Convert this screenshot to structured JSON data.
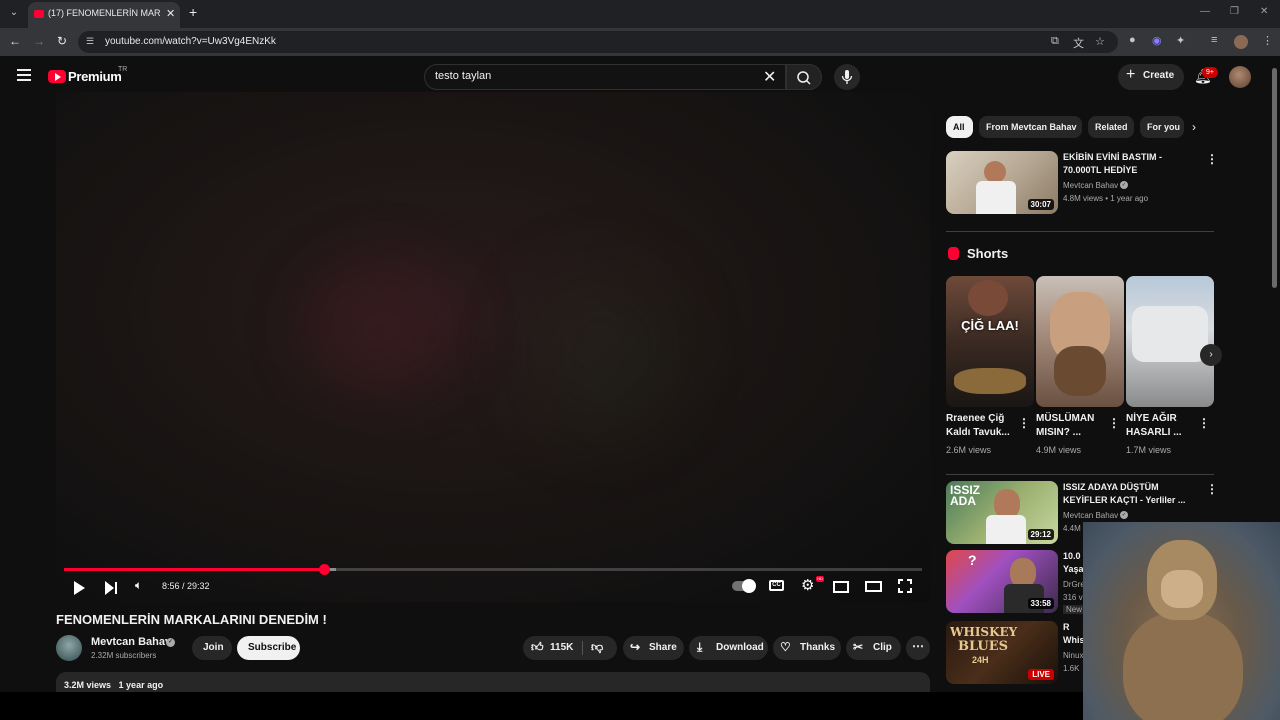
{
  "browser": {
    "tab_title": "(17) FENOMENLERİN MARKALA",
    "url": "youtube.com/watch?v=Uw3Vg4ENzKk"
  },
  "masthead": {
    "logo_text": "Premium",
    "country": "TR",
    "search_value": "testo taylan",
    "create_label": "Create",
    "notification_count": "9+"
  },
  "player": {
    "time": "8:56 / 29:32",
    "progress_fraction": 0.303,
    "buffered_fraction": 0.317
  },
  "video": {
    "title": "FENOMENLERİN MARKALARINI DENEDİM !",
    "channel": "Mevtcan Bahav",
    "subscribers": "2.32M subscribers",
    "join_label": "Join",
    "subscribe_label": "Subscribe",
    "likes": "115K",
    "share_label": "Share",
    "download_label": "Download",
    "thanks_label": "Thanks",
    "clip_label": "Clip",
    "views": "3.2M views",
    "age": "1 year ago"
  },
  "chips": [
    "All",
    "From Mevtcan Bahav",
    "Related",
    "For you"
  ],
  "recommendations": [
    {
      "title1": "EKİBİN EVİNİ BASTIM -",
      "title2": "70.000TL HEDİYE",
      "channel": "Mevtcan Bahav",
      "meta": "4.8M views • 1 year ago",
      "duration": "30:07"
    },
    {
      "title1": "ISSIZ ADAYA DÜŞTÜM",
      "title2": "KEYİFLER KAÇTI - Yerliler ...",
      "channel": "Mevtcan Bahav",
      "meta": "4.4M",
      "duration": "29:12",
      "thumb_text": "ISSIZ ADA"
    },
    {
      "title1": "10.0",
      "title2": "Yaşa",
      "channel": "DrGre",
      "meta": "316 v",
      "badge": "New",
      "duration": "33:58"
    },
    {
      "title1": "R",
      "title2": "Whis",
      "channel": "Ninux",
      "meta": "1.6K",
      "live_label": "LIVE",
      "thumb_text1": "WHISKEY",
      "thumb_text2": "BLUES",
      "thumb_text3": "24H"
    }
  ],
  "shorts": {
    "heading": "Shorts",
    "items": [
      {
        "title1": "Rraenee Çiğ",
        "title2": "Kaldı Tavuk...",
        "views": "2.6M views",
        "overlay": "ÇİĞ LAA!"
      },
      {
        "title1": "MÜSLÜMAN",
        "title2": "MISIN? ...",
        "views": "4.9M views"
      },
      {
        "title1": "NİYE AĞIR",
        "title2": "HASARLI ...",
        "views": "1.7M views"
      }
    ]
  }
}
